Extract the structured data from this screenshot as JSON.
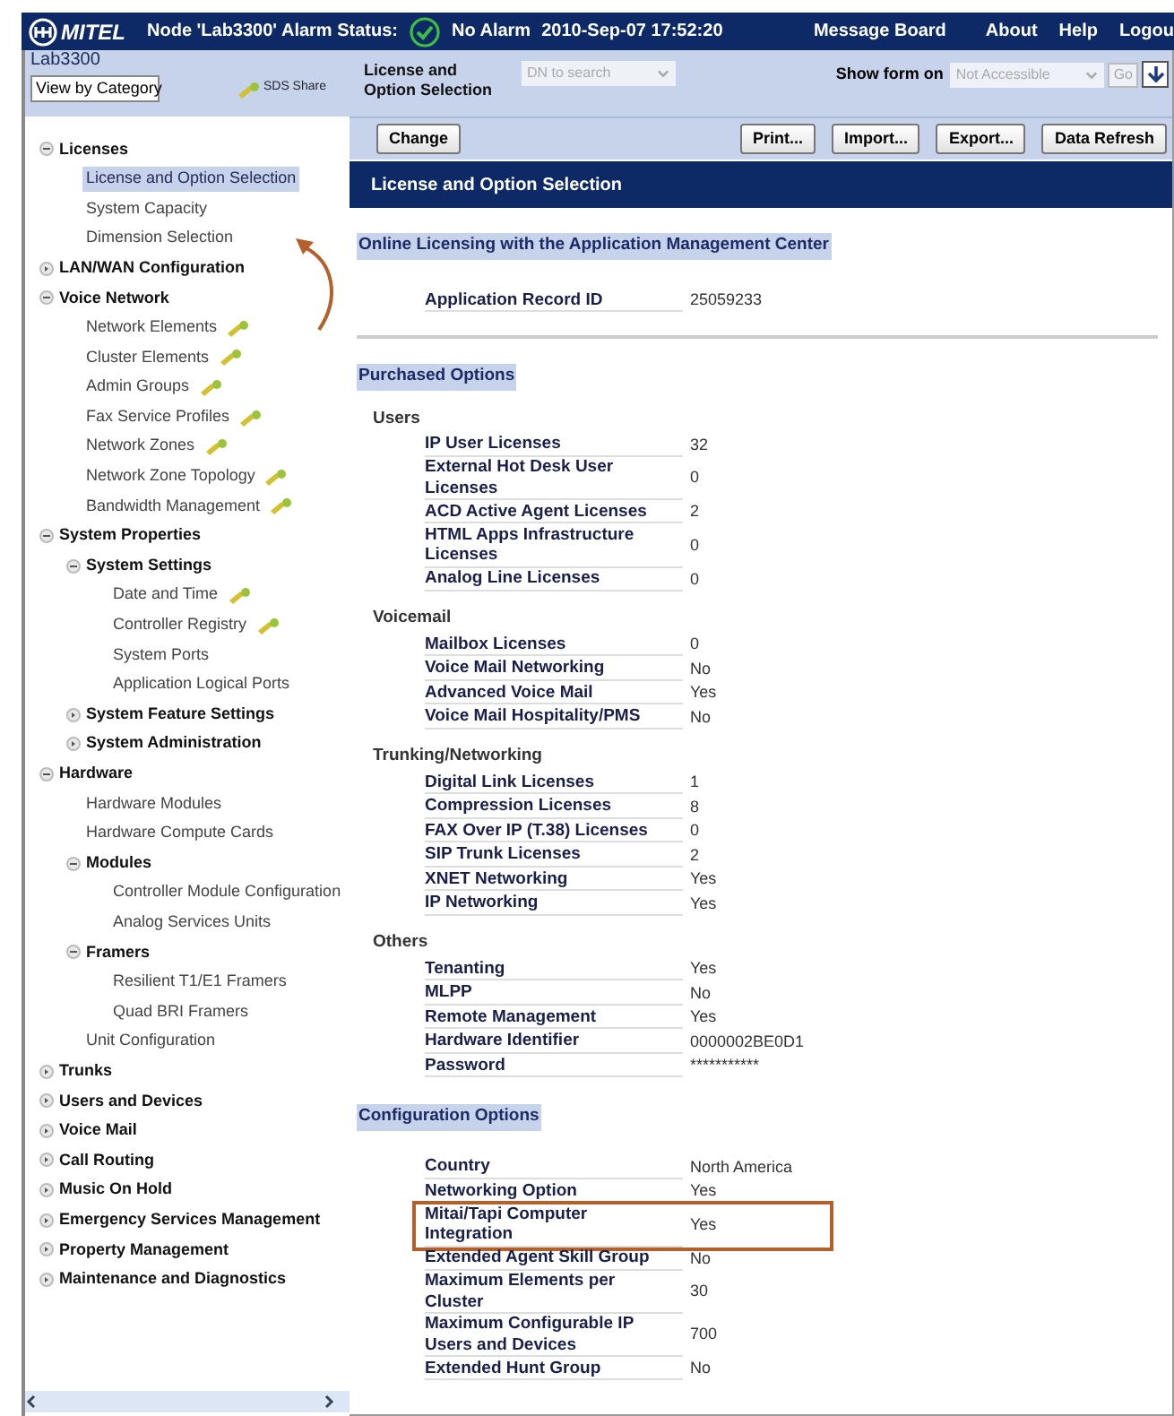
{
  "top_bar": {
    "logo": "MITEL",
    "node_status": "Node 'Lab3300' Alarm Status:",
    "alarm": "No Alarm",
    "timestamp": "2010-Sep-07 17:52:20",
    "links": [
      "Message Board",
      "About",
      "Help",
      "Logou"
    ]
  },
  "sidebar": {
    "system": "Lab3300",
    "view": "View by Category",
    "share": "SDS Share",
    "tree": [
      {
        "label": "Licenses",
        "expanded": true,
        "children": [
          {
            "label": "License and Option Selection",
            "selected": true,
            "key": false
          },
          {
            "label": "System Capacity",
            "selected": false,
            "key": false
          },
          {
            "label": "Dimension Selection",
            "selected": false,
            "key": false
          }
        ]
      },
      {
        "label": "LAN/WAN Configuration",
        "expanded": false
      },
      {
        "label": "Voice Network",
        "expanded": true,
        "children": [
          {
            "label": "Network Elements",
            "selected": false,
            "key": true
          },
          {
            "label": "Cluster Elements",
            "selected": false,
            "key": true
          },
          {
            "label": "Admin Groups",
            "selected": false,
            "key": true
          },
          {
            "label": "Fax Service Profiles",
            "selected": false,
            "key": true
          },
          {
            "label": "Network Zones",
            "selected": false,
            "key": true
          },
          {
            "label": "Network Zone Topology",
            "selected": false,
            "key": true
          },
          {
            "label": "Bandwidth Management",
            "selected": false,
            "key": true
          }
        ]
      },
      {
        "label": "System Properties",
        "expanded": true,
        "children": [
          {
            "label": "System Settings",
            "expanded": true,
            "children": [
              {
                "label": "Date and Time",
                "selected": false,
                "key": true
              },
              {
                "label": "Controller Registry",
                "selected": false,
                "key": true
              },
              {
                "label": "System Ports",
                "selected": false,
                "key": false
              },
              {
                "label": "Application Logical Ports",
                "selected": false,
                "key": false
              }
            ]
          },
          {
            "label": "System Feature Settings",
            "expanded": false
          },
          {
            "label": "System Administration",
            "expanded": false
          }
        ]
      },
      {
        "label": "Hardware",
        "expanded": true,
        "children": [
          {
            "label": "Hardware Modules",
            "selected": false,
            "key": false
          },
          {
            "label": "Hardware Compute Cards",
            "selected": false,
            "key": false
          },
          {
            "label": "Modules",
            "expanded": true,
            "children": [
              {
                "label": "Controller Module Configuration",
                "selected": false,
                "key": false
              },
              {
                "label": "Analog Services Units",
                "selected": false,
                "key": false
              }
            ]
          },
          {
            "label": "Framers",
            "expanded": true,
            "children": [
              {
                "label": "Resilient T1/E1 Framers",
                "selected": false,
                "key": false
              },
              {
                "label": "Quad BRI Framers",
                "selected": false,
                "key": false
              }
            ]
          },
          {
            "label": "Unit Configuration",
            "selected": false,
            "key": false
          }
        ]
      },
      {
        "label": "Trunks",
        "expanded": false
      },
      {
        "label": "Users and Devices",
        "expanded": false
      },
      {
        "label": "Voice Mail",
        "expanded": false
      },
      {
        "label": "Call Routing",
        "expanded": false
      },
      {
        "label": "Music On Hold",
        "expanded": false
      },
      {
        "label": "Emergency Services Management",
        "expanded": false
      },
      {
        "label": "Property Management",
        "expanded": false
      },
      {
        "label": "Maintenance and Diagnostics",
        "expanded": false
      }
    ]
  },
  "form_header": {
    "form_name": "License and Option Selection",
    "dn_search": {
      "placeholder": "DN to search"
    },
    "show_form_label": "Show form on",
    "show_form_value": "Not Accessible",
    "go": "Go"
  },
  "toolbar": {
    "left": [
      "Change"
    ],
    "right": [
      "Print...",
      "Import...",
      "Export...",
      "Data Refresh"
    ]
  },
  "page_title": "License and Option Selection",
  "sections": [
    {
      "title": "Online Licensing with the Application Management Center",
      "groups": [
        {
          "rows": [
            {
              "label": "Application Record ID",
              "value": "25059233",
              "highlighted": false
            }
          ]
        }
      ]
    },
    {
      "title": "Purchased Options",
      "groups": [
        {
          "name": "Users",
          "rows": [
            {
              "label": "IP User Licenses",
              "value": "32",
              "highlighted": false
            },
            {
              "label": "External Hot Desk User Licenses",
              "value": "0",
              "highlighted": false
            },
            {
              "label": "ACD Active Agent Licenses",
              "value": "2",
              "highlighted": false
            },
            {
              "label": "HTML Apps Infrastructure Licenses",
              "value": "0",
              "highlighted": false
            },
            {
              "label": "Analog Line Licenses",
              "value": "0",
              "highlighted": false
            }
          ]
        },
        {
          "name": "Voicemail",
          "rows": [
            {
              "label": "Mailbox Licenses",
              "value": "0",
              "highlighted": false
            },
            {
              "label": "Voice Mail Networking",
              "value": "No",
              "highlighted": false
            },
            {
              "label": "Advanced Voice Mail",
              "value": "Yes",
              "highlighted": false
            },
            {
              "label": "Voice Mail Hospitality/PMS",
              "value": "No",
              "highlighted": false
            }
          ]
        },
        {
          "name": "Trunking/Networking",
          "rows": [
            {
              "label": "Digital Link Licenses",
              "value": "1",
              "highlighted": false
            },
            {
              "label": "Compression Licenses",
              "value": "8",
              "highlighted": false
            },
            {
              "label": "FAX Over IP (T.38) Licenses",
              "value": "0",
              "highlighted": false
            },
            {
              "label": "SIP Trunk Licenses",
              "value": "2",
              "highlighted": false
            },
            {
              "label": "XNET Networking",
              "value": "Yes",
              "highlighted": false
            },
            {
              "label": "IP Networking",
              "value": "Yes",
              "highlighted": false
            }
          ]
        },
        {
          "name": "Others",
          "rows": [
            {
              "label": "Tenanting",
              "value": "Yes",
              "highlighted": false
            },
            {
              "label": "MLPP",
              "value": "No",
              "highlighted": false
            },
            {
              "label": "Remote Management",
              "value": "Yes",
              "highlighted": false
            },
            {
              "label": "Hardware Identifier",
              "value": "0000002BE0D1",
              "highlighted": false
            },
            {
              "label": "Password",
              "value": "***********",
              "highlighted": false
            }
          ]
        }
      ]
    },
    {
      "title": "Configuration Options",
      "groups": [
        {
          "rows": [
            {
              "label": "Country",
              "value": "North America",
              "highlighted": false
            },
            {
              "label": "Networking Option",
              "value": "Yes",
              "highlighted": false
            },
            {
              "label": "Mitai/Tapi Computer Integration",
              "value": "Yes",
              "highlighted": true
            },
            {
              "label": "Extended Agent Skill Group",
              "value": "No",
              "highlighted": false
            },
            {
              "label": "Maximum Elements per Cluster",
              "value": "30",
              "highlighted": false
            },
            {
              "label": "Maximum Configurable IP Users and Devices",
              "value": "700",
              "highlighted": false
            },
            {
              "label": "Extended Hunt Group",
              "value": "No",
              "highlighted": false
            }
          ]
        }
      ]
    }
  ]
}
